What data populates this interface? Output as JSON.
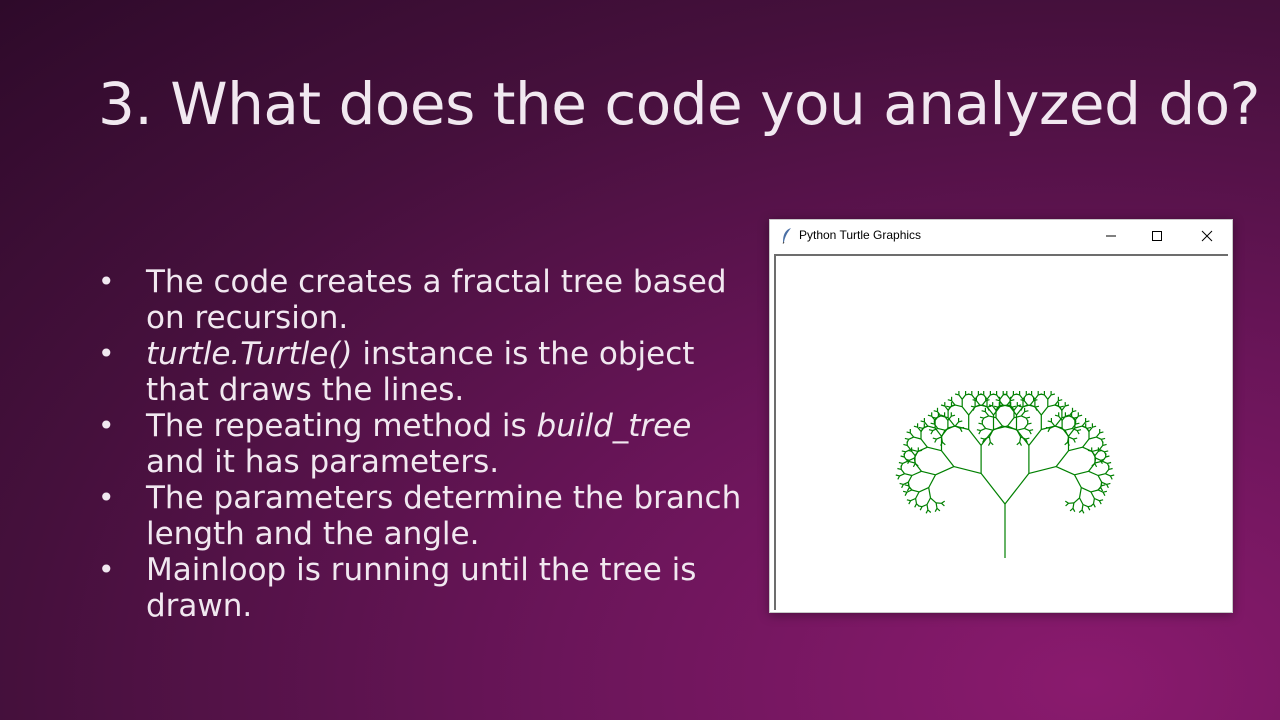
{
  "slide": {
    "title": "3. What does the code you analyzed do?",
    "bullets": [
      {
        "parts": [
          {
            "text": "The code creates a fractal tree based on recursion.",
            "italic": false
          }
        ]
      },
      {
        "parts": [
          {
            "text": "turtle.Turtle()",
            "italic": true
          },
          {
            "text": " instance is the object that draws the lines.",
            "italic": false
          }
        ]
      },
      {
        "parts": [
          {
            "text": "The repeating method is ",
            "italic": false
          },
          {
            "text": "build_tree",
            "italic": true
          },
          {
            "text": " and it has parameters.",
            "italic": false
          }
        ]
      },
      {
        "parts": [
          {
            "text": "The parameters  determine the branch length and the angle.",
            "italic": false
          }
        ]
      },
      {
        "parts": [
          {
            "text": "Mainloop is running until the tree is drawn.",
            "italic": false
          }
        ]
      }
    ]
  },
  "window": {
    "title": "Python Turtle Graphics",
    "app_icon": "feather-icon",
    "controls": {
      "minimize": "minimize-icon",
      "maximize": "maximize-icon",
      "close": "close-icon"
    }
  },
  "tree": {
    "color": "#008000",
    "depth": 8,
    "branch_angle_deg": 38,
    "length_ratio": 0.72
  },
  "colors": {
    "background_dark": "#2e0a2a",
    "background_light": "#8a1a6e",
    "text": "#f1e8f0"
  }
}
